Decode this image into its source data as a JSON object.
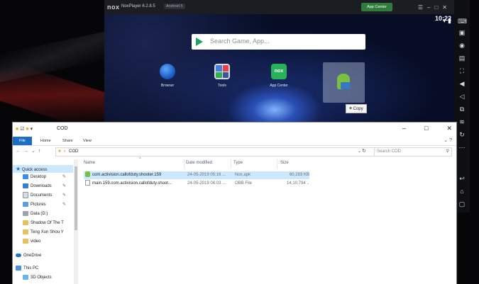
{
  "nox": {
    "logo": "nox",
    "title": "NoxPlayer 6.2.8.5",
    "android": "Android 5",
    "app_center_label": "App Center",
    "time": "10:22",
    "search_placeholder": "Search Game, App...",
    "apps": [
      {
        "label": "Browser"
      },
      {
        "label": "Tools"
      },
      {
        "label": "App Center"
      }
    ],
    "app_center_icon_text": "nox",
    "copy_tooltip": "Copy"
  },
  "explorer": {
    "title": "COD",
    "ribbon_tabs": [
      "File",
      "Home",
      "Share",
      "View"
    ],
    "address": "COD",
    "search_placeholder": "Search COD",
    "nav_items": [
      {
        "label": "Quick access",
        "icon": "star-icon"
      },
      {
        "label": "Desktop",
        "icon": "desktop-icon",
        "pinned": true
      },
      {
        "label": "Downloads",
        "icon": "download-icon",
        "pinned": true
      },
      {
        "label": "Documents",
        "icon": "document-icon",
        "pinned": true
      },
      {
        "label": "Pictures",
        "icon": "picture-icon",
        "pinned": true
      },
      {
        "label": "Data (D:)",
        "icon": "drive-icon"
      },
      {
        "label": "Shadow Of The T",
        "icon": "folder-icon"
      },
      {
        "label": "Teng Xun Shou Y",
        "icon": "folder-icon"
      },
      {
        "label": "video",
        "icon": "folder-icon"
      },
      {
        "label": "OneDrive",
        "icon": "cloud-icon"
      },
      {
        "label": "This PC",
        "icon": "computer-icon"
      },
      {
        "label": "3D Objects",
        "icon": "cube-icon"
      }
    ],
    "columns": [
      "Name",
      "Date modified",
      "Type",
      "Size"
    ],
    "files": [
      {
        "name": "com.activision.callofduty.shooter.159",
        "date": "24-05-2019 05:16 ...",
        "type": "Nox.apk",
        "size": "60,283 KB"
      },
      {
        "name": "main.159.com.activision.callofduty.shoot...",
        "date": "24-05-2019 06:03 ...",
        "type": "OBB File",
        "size": "14,10,794 ..."
      }
    ]
  },
  "colors": {
    "file_tab": "#1a6fc4",
    "selection": "#cce8ff",
    "app_center_green": "#2f7c3c"
  }
}
